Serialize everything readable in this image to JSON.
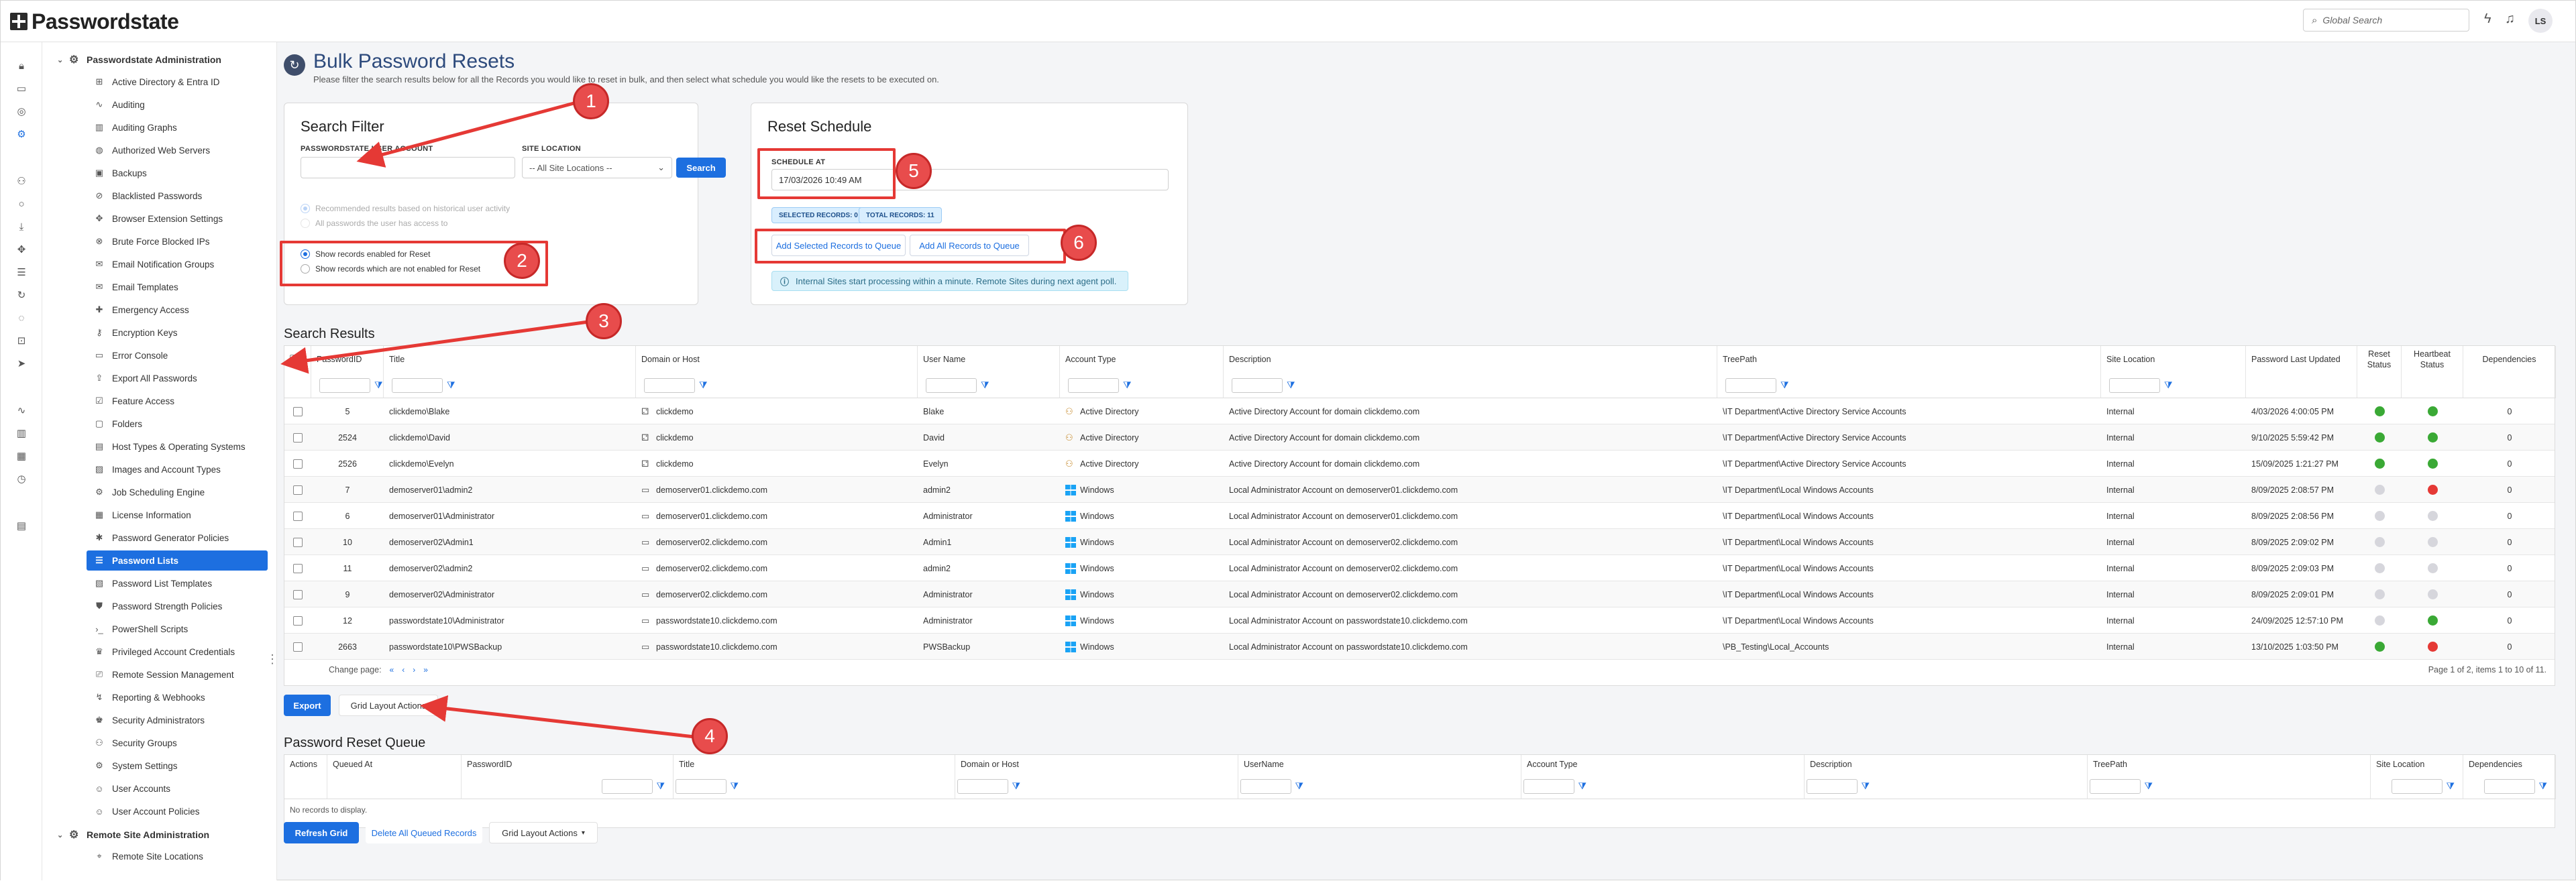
{
  "app": {
    "name": "Passwordstate"
  },
  "header": {
    "search_placeholder": "Global Search",
    "user_initials": "LS"
  },
  "sidebar": {
    "group": "Passwordstate Administration",
    "items": [
      {
        "label": "Active Directory & Entra ID",
        "icon": "directory-icon"
      },
      {
        "label": "Auditing",
        "icon": "activity-icon"
      },
      {
        "label": "Auditing Graphs",
        "icon": "graph-icon"
      },
      {
        "label": "Authorized Web Servers",
        "icon": "globe-icon"
      },
      {
        "label": "Backups",
        "icon": "database-icon"
      },
      {
        "label": "Blacklisted Passwords",
        "icon": "blacklist-icon"
      },
      {
        "label": "Browser Extension Settings",
        "icon": "extension-icon"
      },
      {
        "label": "Brute Force Blocked IPs",
        "icon": "block-icon"
      },
      {
        "label": "Email Notification Groups",
        "icon": "email-group-icon"
      },
      {
        "label": "Email Templates",
        "icon": "email-icon"
      },
      {
        "label": "Emergency Access",
        "icon": "emergency-icon"
      },
      {
        "label": "Encryption Keys",
        "icon": "key-icon"
      },
      {
        "label": "Error Console",
        "icon": "console-icon"
      },
      {
        "label": "Export All Passwords",
        "icon": "export-icon"
      },
      {
        "label": "Feature Access",
        "icon": "feature-icon"
      },
      {
        "label": "Folders",
        "icon": "folder-icon"
      },
      {
        "label": "Host Types & Operating Systems",
        "icon": "host-icon"
      },
      {
        "label": "Images and Account Types",
        "icon": "image-icon"
      },
      {
        "label": "Job Scheduling Engine",
        "icon": "gears-icon"
      },
      {
        "label": "License Information",
        "icon": "license-icon"
      },
      {
        "label": "Password Generator Policies",
        "icon": "generator-icon"
      },
      {
        "label": "Password Lists",
        "icon": "list-icon"
      },
      {
        "label": "Password List Templates",
        "icon": "template-icon"
      },
      {
        "label": "Password Strength Policies",
        "icon": "strength-icon"
      },
      {
        "label": "PowerShell Scripts",
        "icon": "powershell-icon"
      },
      {
        "label": "Privileged Account Credentials",
        "icon": "privileged-icon"
      },
      {
        "label": "Remote Session Management",
        "icon": "remote-session-icon"
      },
      {
        "label": "Reporting & Webhooks",
        "icon": "report-icon"
      },
      {
        "label": "Security Administrators",
        "icon": "admin-icon"
      },
      {
        "label": "Security Groups",
        "icon": "group-icon"
      },
      {
        "label": "System Settings",
        "icon": "settings-icon"
      },
      {
        "label": "User Accounts",
        "icon": "user-icon"
      },
      {
        "label": "User Account Policies",
        "icon": "user-policy-icon"
      }
    ],
    "active_index": 21,
    "group2": "Remote Site Administration",
    "group2_items": [
      {
        "label": "Remote Site Locations",
        "icon": "location-icon"
      }
    ]
  },
  "page": {
    "title": "Bulk Password Resets",
    "subtitle": "Please filter the search results below for all the Records you would like to reset in bulk, and then select what schedule you would like the resets to be executed on."
  },
  "search_filter": {
    "title": "Search Filter",
    "user_label": "PASSWORDSTATE USER ACCOUNT",
    "user_value": "",
    "site_label": "SITE LOCATION",
    "site_value": "-- All Site Locations --",
    "search_button": "Search",
    "radio_recommended": "Recommended results based on historical user activity",
    "radio_all": "All passwords the user has access to",
    "radio_enabled": "Show records enabled for Reset",
    "radio_not_enabled": "Show records which are not enabled for Reset"
  },
  "reset_schedule": {
    "title": "Reset Schedule",
    "schedule_label": "SCHEDULE AT",
    "schedule_value": "17/03/2026 10:49 AM",
    "selected_records": "SELECTED RECORDS: 0",
    "total_records": "TOTAL RECORDS: 11",
    "add_selected": "Add Selected Records to Queue",
    "add_all": "Add All Records to Queue",
    "info": "Internal Sites start processing within a minute. Remote Sites during next agent poll."
  },
  "search_results": {
    "title": "Search Results",
    "columns": [
      "PasswordID",
      "Title",
      "Domain or Host",
      "User Name",
      "Account Type",
      "Description",
      "TreePath",
      "Site Location",
      "Password Last Updated",
      "Reset Status",
      "Heartbeat Status",
      "Dependencies"
    ],
    "rows": [
      {
        "id": "5",
        "title": "clickdemo\\Blake",
        "host": "clickdemo",
        "host_type": "domain",
        "user": "Blake",
        "acct": "Active Directory",
        "acct_type": "ad",
        "desc": "Active Directory Account for domain clickdemo.com",
        "tree": "\\IT Department\\Active Directory Service Accounts",
        "site": "Internal",
        "updated": "4/03/2026 4:00:05 PM",
        "reset": "#3aa935",
        "heartbeat": "#3aa935",
        "deps": "0"
      },
      {
        "id": "2524",
        "title": "clickdemo\\David",
        "host": "clickdemo",
        "host_type": "domain",
        "user": "David",
        "acct": "Active Directory",
        "acct_type": "ad",
        "desc": "Active Directory Account for domain clickdemo.com",
        "tree": "\\IT Department\\Active Directory Service Accounts",
        "site": "Internal",
        "updated": "9/10/2025 5:59:42 PM",
        "reset": "#3aa935",
        "heartbeat": "#3aa935",
        "deps": "0"
      },
      {
        "id": "2526",
        "title": "clickdemo\\Evelyn",
        "host": "clickdemo",
        "host_type": "domain",
        "user": "Evelyn",
        "acct": "Active Directory",
        "acct_type": "ad",
        "desc": "Active Directory Account for domain clickdemo.com",
        "tree": "\\IT Department\\Active Directory Service Accounts",
        "site": "Internal",
        "updated": "15/09/2025 1:21:27 PM",
        "reset": "#3aa935",
        "heartbeat": "#3aa935",
        "deps": "0"
      },
      {
        "id": "7",
        "title": "demoserver01\\admin2",
        "host": "demoserver01.clickdemo.com",
        "host_type": "server",
        "user": "admin2",
        "acct": "Windows",
        "acct_type": "win",
        "desc": "Local Administrator Account on demoserver01.clickdemo.com",
        "tree": "\\IT Department\\Local Windows Accounts",
        "site": "Internal",
        "updated": "8/09/2025 2:08:57 PM",
        "reset": "#d6d6dc",
        "heartbeat": "#e53935",
        "deps": "0"
      },
      {
        "id": "6",
        "title": "demoserver01\\Administrator",
        "host": "demoserver01.clickdemo.com",
        "host_type": "server",
        "user": "Administrator",
        "acct": "Windows",
        "acct_type": "win",
        "desc": "Local Administrator Account on demoserver01.clickdemo.com",
        "tree": "\\IT Department\\Local Windows Accounts",
        "site": "Internal",
        "updated": "8/09/2025 2:08:56 PM",
        "reset": "#d6d6dc",
        "heartbeat": "#d6d6dc",
        "deps": "0"
      },
      {
        "id": "10",
        "title": "demoserver02\\Admin1",
        "host": "demoserver02.clickdemo.com",
        "host_type": "server",
        "user": "Admin1",
        "acct": "Windows",
        "acct_type": "win",
        "desc": "Local Administrator Account on demoserver02.clickdemo.com",
        "tree": "\\IT Department\\Local Windows Accounts",
        "site": "Internal",
        "updated": "8/09/2025 2:09:02 PM",
        "reset": "#d6d6dc",
        "heartbeat": "#d6d6dc",
        "deps": "0"
      },
      {
        "id": "11",
        "title": "demoserver02\\admin2",
        "host": "demoserver02.clickdemo.com",
        "host_type": "server",
        "user": "admin2",
        "acct": "Windows",
        "acct_type": "win",
        "desc": "Local Administrator Account on demoserver02.clickdemo.com",
        "tree": "\\IT Department\\Local Windows Accounts",
        "site": "Internal",
        "updated": "8/09/2025 2:09:03 PM",
        "reset": "#d6d6dc",
        "heartbeat": "#d6d6dc",
        "deps": "0"
      },
      {
        "id": "9",
        "title": "demoserver02\\Administrator",
        "host": "demoserver02.clickdemo.com",
        "host_type": "server",
        "user": "Administrator",
        "acct": "Windows",
        "acct_type": "win",
        "desc": "Local Administrator Account on demoserver02.clickdemo.com",
        "tree": "\\IT Department\\Local Windows Accounts",
        "site": "Internal",
        "updated": "8/09/2025 2:09:01 PM",
        "reset": "#d6d6dc",
        "heartbeat": "#d6d6dc",
        "deps": "0"
      },
      {
        "id": "12",
        "title": "passwordstate10\\Administrator",
        "host": "passwordstate10.clickdemo.com",
        "host_type": "server",
        "user": "Administrator",
        "acct": "Windows",
        "acct_type": "win",
        "desc": "Local Administrator Account on passwordstate10.clickdemo.com",
        "tree": "\\IT Department\\Local Windows Accounts",
        "site": "Internal",
        "updated": "24/09/2025 12:57:10 PM",
        "reset": "#d6d6dc",
        "heartbeat": "#3aa935",
        "deps": "0"
      },
      {
        "id": "2663",
        "title": "passwordstate10\\PWSBackup",
        "host": "passwordstate10.clickdemo.com",
        "host_type": "server",
        "user": "PWSBackup",
        "acct": "Windows",
        "acct_type": "win",
        "desc": "Local Administrator Account on passwordstate10.clickdemo.com",
        "tree": "\\PB_Testing\\Local_Accounts",
        "site": "Internal",
        "updated": "13/10/2025 1:03:50 PM",
        "reset": "#3aa935",
        "heartbeat": "#e53935",
        "deps": "0"
      }
    ],
    "change_page": "Change page:",
    "page_info": "Page 1 of 2, items 1 to 10 of 11."
  },
  "results_actions": {
    "export": "Export",
    "grid_layout": "Grid Layout Actions"
  },
  "queue": {
    "title": "Password Reset Queue",
    "columns": [
      "Actions",
      "Queued At",
      "PasswordID",
      "Title",
      "Domain or Host",
      "UserName",
      "Account Type",
      "Description",
      "TreePath",
      "Site Location",
      "Dependencies"
    ],
    "empty": "No records to display.",
    "refresh": "Refresh Grid",
    "delete_all": "Delete All Queued Records",
    "grid_layout": "Grid Layout Actions"
  },
  "annotations": [
    "1",
    "2",
    "3",
    "4",
    "5",
    "6"
  ],
  "colors": {
    "accent": "#1d6fe0",
    "annotation": "#e53935",
    "ok": "#3aa935",
    "fail": "#e53935",
    "unknown": "#d6d6dc"
  }
}
